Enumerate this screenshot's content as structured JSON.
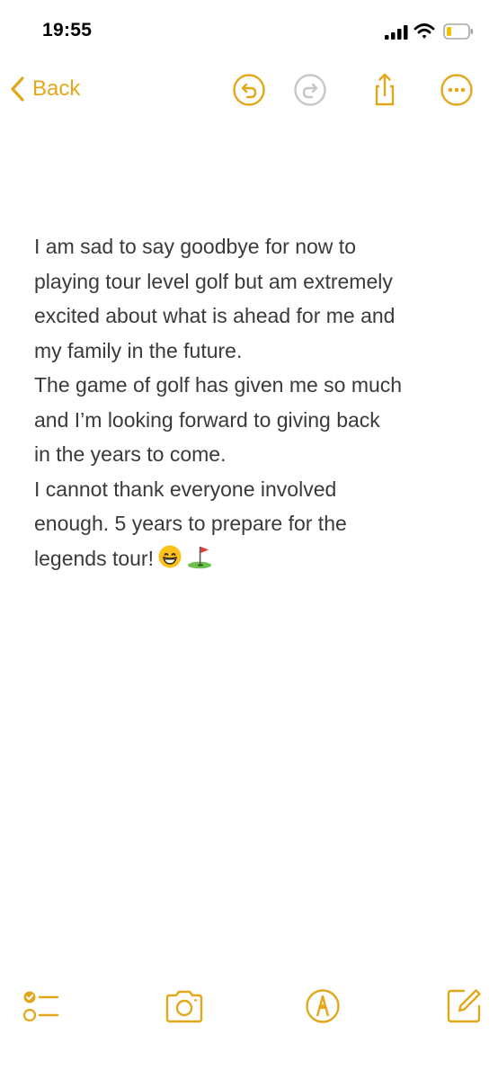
{
  "status": {
    "time": "19:55"
  },
  "nav": {
    "back_label": "Back",
    "accent_color": "#E3A81A"
  },
  "note": {
    "lines": [
      "I am sad to say goodbye for now to",
      "playing tour level golf but am extremely",
      "excited about what is ahead for me and",
      "my family in the future.",
      "The game of golf has given me so much",
      "and I’m looking forward to giving back",
      "in the years to come.",
      "I cannot thank everyone involved",
      "enough. 5 years to prepare for the",
      "legends tour!"
    ],
    "trailing_icons": [
      "grinning-face-emoji",
      "golf-flag-emoji"
    ]
  },
  "toolbar": {
    "icons": [
      "checklist-icon",
      "camera-icon",
      "markup-pen-icon",
      "compose-icon"
    ]
  }
}
